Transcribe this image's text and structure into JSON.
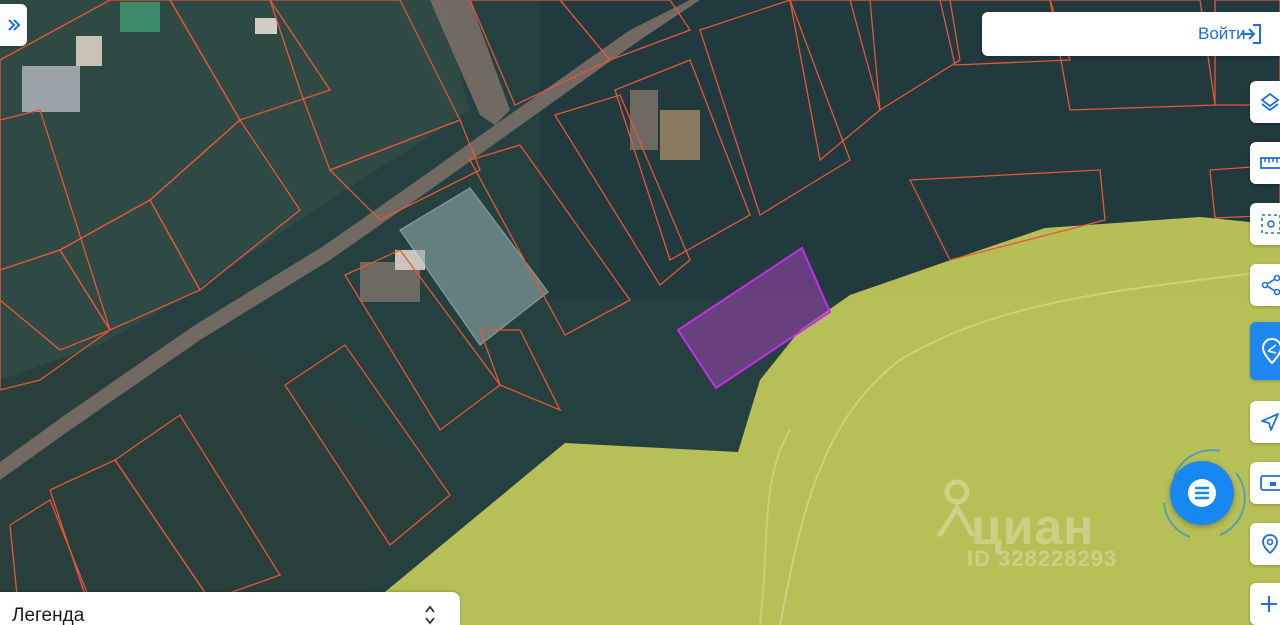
{
  "header": {
    "login_label": "Войти"
  },
  "legend": {
    "title": "Легенда"
  },
  "watermark": {
    "brand": "циан",
    "listing_id": "ID 328228293"
  },
  "toolbar": {
    "items": [
      {
        "name": "layers",
        "icon": "layers-icon"
      },
      {
        "name": "ruler",
        "icon": "ruler-icon"
      },
      {
        "name": "area-select",
        "icon": "area-select-icon"
      },
      {
        "name": "share",
        "icon": "share-icon"
      },
      {
        "name": "parcel-info",
        "icon": "parcel-info-icon",
        "active": true
      },
      {
        "name": "locate",
        "icon": "location-arrow-icon"
      },
      {
        "name": "panel",
        "icon": "panel-icon"
      },
      {
        "name": "place",
        "icon": "place-pin-icon"
      },
      {
        "name": "zoom-in",
        "icon": "plus-icon"
      }
    ]
  },
  "colors": {
    "parcel_border": "#e8553a",
    "selected_parcel": "#b02fd6",
    "zone_fill": "#c8d15a",
    "accent": "#1f86f0"
  }
}
